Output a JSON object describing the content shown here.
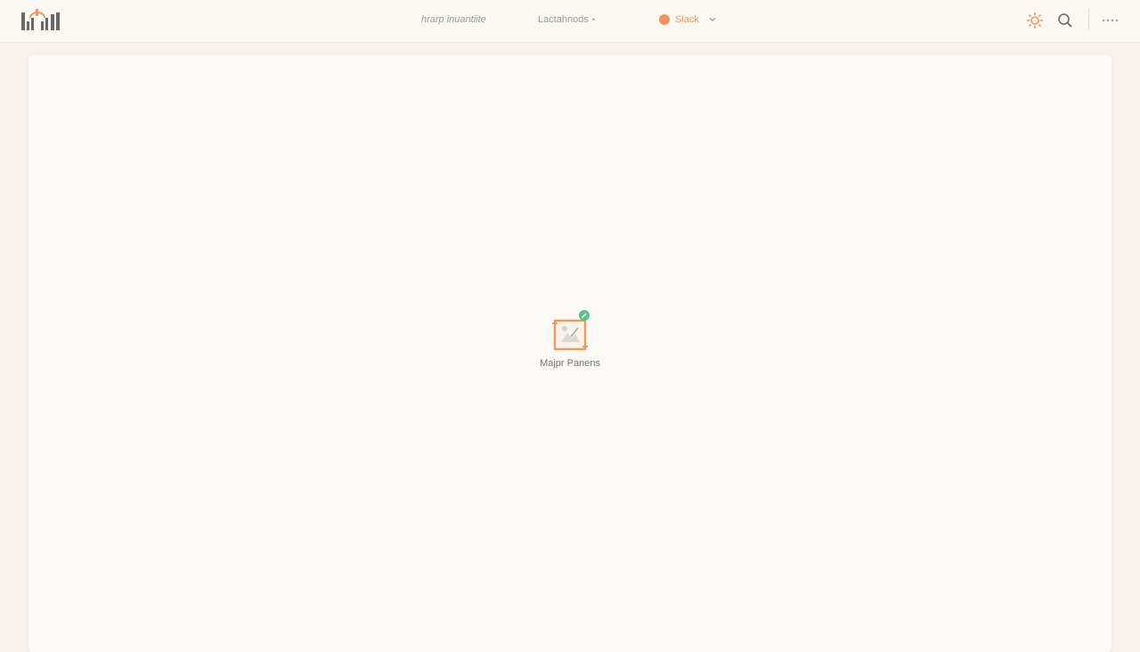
{
  "app": {
    "logo_icon": "bar-chart-logo-icon",
    "accent": "#f1945a"
  },
  "nav": {
    "item1": "hrarp inuantiite",
    "item2": "Lactahnods",
    "item2_caret": "•",
    "workspace": {
      "label": "Slack",
      "status_color": "#f1945a",
      "chevron": "chevron-down-icon"
    }
  },
  "toolbar": {
    "icons": [
      "sun-icon",
      "search-icon",
      "more-icon"
    ]
  },
  "main": {
    "empty_state": {
      "icon": "image-frame-icon",
      "badge_color": "#5cc18a",
      "label": "Majpr Panens"
    }
  }
}
